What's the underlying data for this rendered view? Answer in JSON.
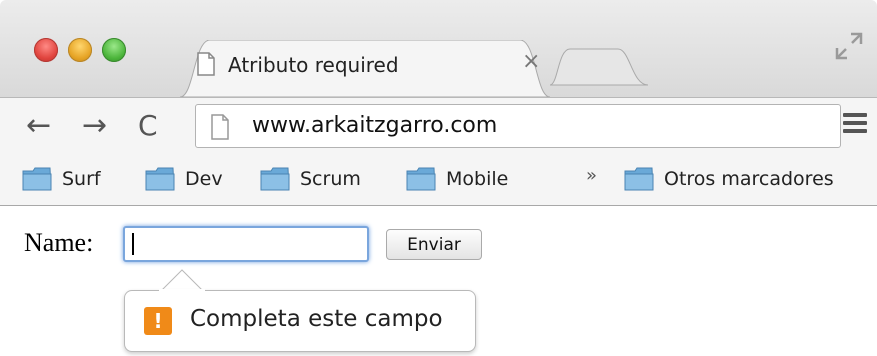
{
  "tab": {
    "title": "Atributo required",
    "close_glyph": "×"
  },
  "toolbar": {
    "back_glyph": "←",
    "forward_glyph": "→",
    "reload_glyph": "C"
  },
  "omnibox": {
    "url": "www.arkaitzgarro.com"
  },
  "bookmarks": {
    "items": [
      {
        "label": "Surf"
      },
      {
        "label": "Dev"
      },
      {
        "label": "Scrum"
      },
      {
        "label": "Mobile"
      }
    ],
    "more_glyph": "»",
    "other": {
      "label": "Otros marcadores"
    }
  },
  "form": {
    "name_label": "Name:",
    "name_value": "",
    "submit_label": "Enviar"
  },
  "validation": {
    "icon_glyph": "!",
    "message": "Completa este campo"
  },
  "colors": {
    "close": "#e0443e",
    "minimize": "#e6a425",
    "maximize": "#4cb53b",
    "warning": "#f08a18",
    "focus_ring": "#6fa0e0",
    "folder": "#6aa9d8"
  },
  "icons": [
    "close-window-icon",
    "minimize-window-icon",
    "maximize-window-icon",
    "page-icon",
    "back-arrow-icon",
    "forward-arrow-icon",
    "reload-icon",
    "menu-icon",
    "folder-icon",
    "warning-icon",
    "fullscreen-icon"
  ]
}
